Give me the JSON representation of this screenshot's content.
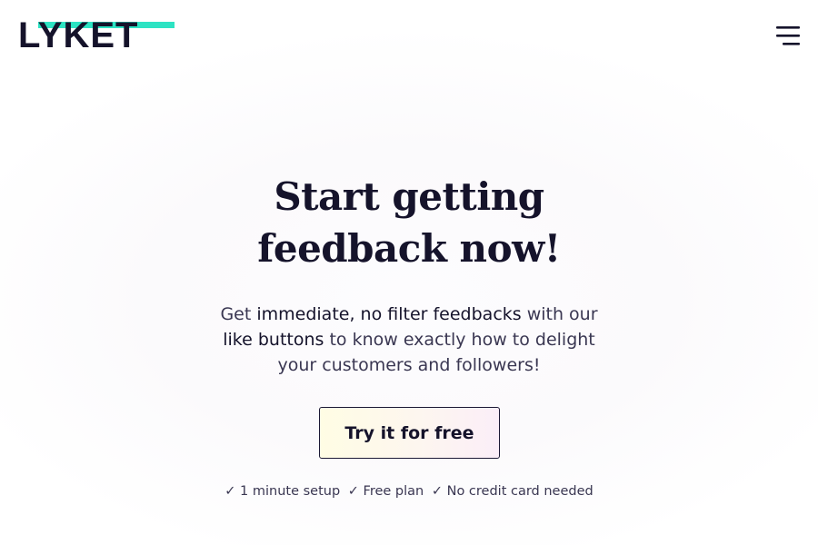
{
  "header": {
    "logo_text": "LYKET",
    "menu_icon": "hamburger-menu-icon",
    "accent_color": "#2de3c3"
  },
  "hero": {
    "title_line1": "Start getting",
    "title_highlight": "feedback",
    "title_line2_rest": "now!",
    "subtitle": {
      "part1": "Get ",
      "strong1": "immediate, no filter feedbacks",
      "part2": " with our ",
      "strong2": "like buttons",
      "part3": " to know exactly how to delight your customers and followers!"
    },
    "cta_label": "Try it for free",
    "features": [
      "✓ 1 minute setup",
      "✓ Free plan",
      "✓ No credit card needed"
    ]
  },
  "colors": {
    "text_dark": "#15132b",
    "highlight": "#37e8c8"
  }
}
